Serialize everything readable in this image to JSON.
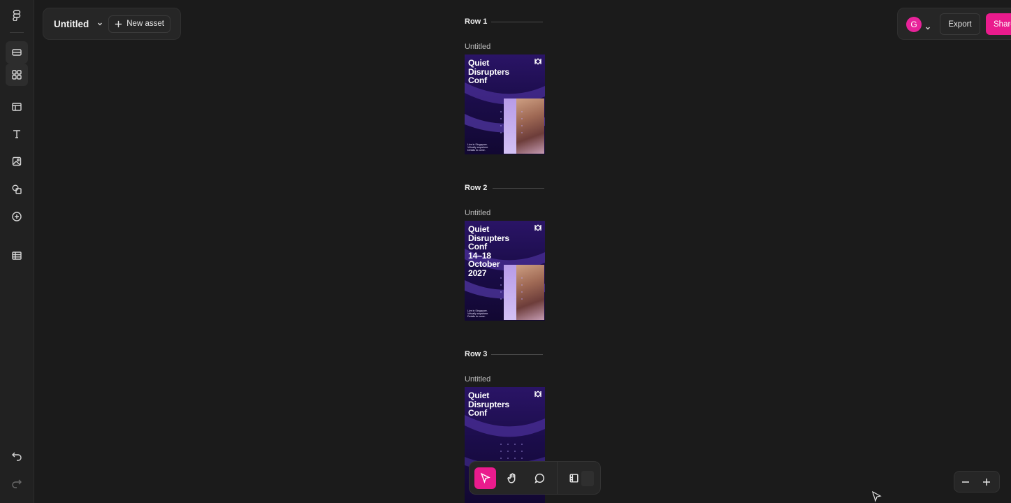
{
  "file": {
    "title": "Untitled",
    "new_asset_label": "New asset"
  },
  "header_right": {
    "avatar_initial": "G",
    "export_label": "Export",
    "share_label": "Share"
  },
  "colors": {
    "accent": "#ea1b8d",
    "canvas": "#1b1b1b",
    "panel": "#262626"
  },
  "left_toolbar": {
    "items": [
      {
        "name": "figma-logo-icon"
      },
      {
        "name": "rows-view-icon",
        "active": true
      },
      {
        "name": "grid-view-icon",
        "active": true
      },
      {
        "name": "layout-template-icon"
      },
      {
        "name": "text-tool-icon"
      },
      {
        "name": "image-tool-icon"
      },
      {
        "name": "shapes-tool-icon"
      },
      {
        "name": "plus-circle-icon"
      },
      {
        "name": "table-icon"
      },
      {
        "name": "undo-icon"
      },
      {
        "name": "redo-icon"
      }
    ]
  },
  "rows": [
    {
      "label": "Row 1",
      "asset_label": "Untitled",
      "poster_title": "Quiet\nDisrupters\nConf",
      "poster_footer": "Live in Singapore.\nVirtually anywhere.\nDetails to come."
    },
    {
      "label": "Row 2",
      "asset_label": "Untitled",
      "poster_title": "Quiet\nDisrupters\nConf\n14–18\nOctober\n2027",
      "poster_footer": "Live in Singapore.\nVirtually anywhere.\nDetails to come."
    },
    {
      "label": "Row 3",
      "asset_label": "Untitled",
      "poster_title": "Quiet\nDisrupters\nConf",
      "poster_footer": ""
    }
  ],
  "bottom_toolbar": {
    "tools": [
      {
        "name": "select-tool-icon",
        "active": true
      },
      {
        "name": "hand-tool-icon"
      },
      {
        "name": "comment-tool-icon"
      },
      {
        "name": "dev-mode-icon"
      }
    ]
  },
  "zoom": {
    "out_icon": "minus-icon",
    "in_icon": "plus-icon"
  }
}
